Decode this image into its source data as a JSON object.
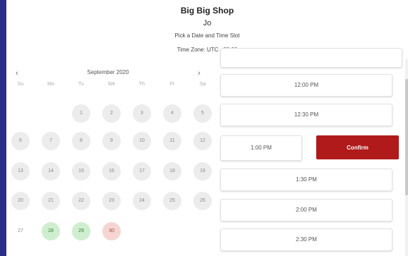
{
  "header": {
    "shop_name": "Big Big Shop",
    "staff_name": "Jo",
    "subtitle": "Pick a Date and Time Slot",
    "timezone": "Time Zone: UTC +08:00"
  },
  "calendar": {
    "prev_icon": "‹",
    "next_icon": "›",
    "month_label": "September 2020",
    "weekdays": [
      "Su",
      "Mo",
      "Tu",
      "We",
      "Th",
      "Fr",
      "Sa"
    ],
    "days": [
      {
        "label": "1",
        "state": "grey"
      },
      {
        "label": "2",
        "state": "grey"
      },
      {
        "label": "3",
        "state": "grey"
      },
      {
        "label": "4",
        "state": "grey"
      },
      {
        "label": "5",
        "state": "grey"
      },
      {
        "label": "6",
        "state": "grey"
      },
      {
        "label": "7",
        "state": "grey"
      },
      {
        "label": "8",
        "state": "grey"
      },
      {
        "label": "9",
        "state": "grey"
      },
      {
        "label": "10",
        "state": "grey"
      },
      {
        "label": "11",
        "state": "grey"
      },
      {
        "label": "12",
        "state": "grey"
      },
      {
        "label": "13",
        "state": "grey"
      },
      {
        "label": "14",
        "state": "grey"
      },
      {
        "label": "15",
        "state": "grey"
      },
      {
        "label": "16",
        "state": "grey"
      },
      {
        "label": "17",
        "state": "grey"
      },
      {
        "label": "18",
        "state": "grey"
      },
      {
        "label": "19",
        "state": "grey"
      },
      {
        "label": "20",
        "state": "grey"
      },
      {
        "label": "21",
        "state": "grey"
      },
      {
        "label": "22",
        "state": "grey"
      },
      {
        "label": "23",
        "state": "grey"
      },
      {
        "label": "24",
        "state": "grey"
      },
      {
        "label": "25",
        "state": "grey"
      },
      {
        "label": "26",
        "state": "grey"
      },
      {
        "label": "27",
        "state": "plain"
      },
      {
        "label": "28",
        "state": "green"
      },
      {
        "label": "29",
        "state": "green"
      },
      {
        "label": "30",
        "state": "red"
      }
    ]
  },
  "time_slots": {
    "slots": [
      "12:00 PM",
      "12:30 PM",
      "1:00 PM",
      "1:30 PM",
      "2:00 PM",
      "2:30 PM"
    ],
    "confirm_label": "Confirm"
  },
  "colors": {
    "background": "#2b2f8a",
    "confirm": "#b01a1a",
    "available_day": "#cfeecf",
    "selected_day": "#f5d5d2",
    "unavailable_day": "#ececec"
  }
}
